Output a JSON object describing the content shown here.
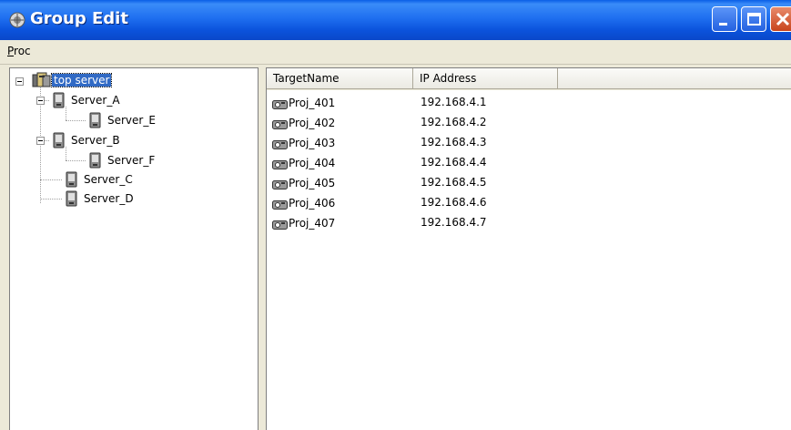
{
  "window": {
    "title": "Group Edit",
    "buttons": [
      "minimize",
      "maximize",
      "close"
    ]
  },
  "menubar": {
    "items": [
      {
        "label": "Proc"
      }
    ]
  },
  "tree": {
    "root": {
      "label": "top server",
      "selected": true,
      "icon": "server-group-icon"
    },
    "nodes": [
      {
        "label": "Server_A",
        "icon": "server-icon",
        "expanded": true
      },
      {
        "label": "Server_E",
        "icon": "server-icon",
        "parent": "Server_A"
      },
      {
        "label": "Server_B",
        "icon": "server-icon",
        "expanded": true
      },
      {
        "label": "Server_F",
        "icon": "server-icon",
        "parent": "Server_B"
      },
      {
        "label": "Server_C",
        "icon": "server-icon"
      },
      {
        "label": "Server_D",
        "icon": "server-icon"
      }
    ]
  },
  "list": {
    "columns": [
      "TargetName",
      "IP Address",
      ""
    ],
    "rows": [
      {
        "name": "Proj_401",
        "ip": "192.168.4.1"
      },
      {
        "name": "Proj_402",
        "ip": "192.168.4.2"
      },
      {
        "name": "Proj_403",
        "ip": "192.168.4.3"
      },
      {
        "name": "Proj_404",
        "ip": "192.168.4.4"
      },
      {
        "name": "Proj_405",
        "ip": "192.168.4.5"
      },
      {
        "name": "Proj_406",
        "ip": "192.168.4.6"
      },
      {
        "name": "Proj_407",
        "ip": "192.168.4.7"
      }
    ],
    "row_icon": "projector-icon"
  },
  "colors": {
    "titlebar": "#0a5ee6",
    "selection": "#316ac5",
    "face": "#ece9d8"
  }
}
